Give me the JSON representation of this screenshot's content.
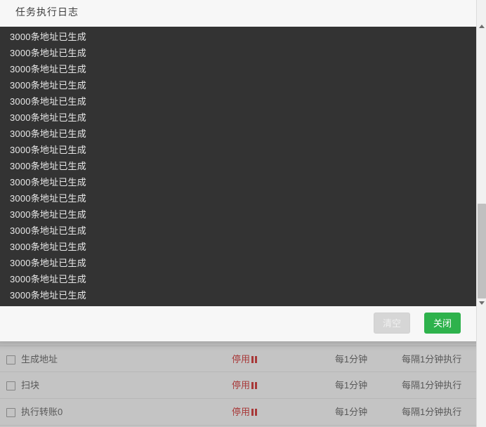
{
  "modal": {
    "title": "任务执行日志",
    "log_line_text": "3000条地址已生成",
    "log_lines": [
      "3000条地址已生成",
      "3000条地址已生成",
      "3000条地址已生成",
      "3000条地址已生成",
      "3000条地址已生成",
      "3000条地址已生成",
      "3000条地址已生成",
      "3000条地址已生成",
      "3000条地址已生成",
      "3000条地址已生成",
      "3000条地址已生成",
      "3000条地址已生成",
      "3000条地址已生成",
      "3000条地址已生成",
      "3000条地址已生成",
      "3000条地址已生成",
      "3000条地址已生成"
    ],
    "footer": {
      "clear_label": "清空",
      "close_label": "关闭"
    },
    "colors": {
      "log_background": "#333333",
      "log_text": "#e9e9e9",
      "close_button": "#2eb24c",
      "clear_button": "#d6d6d6",
      "panel_background": "#f7f7f7"
    }
  },
  "background_table": {
    "rows": [
      {
        "checkbox": "checkbox-unchecked",
        "name": "生成地址",
        "status": "停用",
        "status_icon": "pause-icon",
        "frequency": "每1分钟",
        "description": "每隔1分钟执行"
      },
      {
        "checkbox": "checkbox-unchecked",
        "name": "扫块",
        "status": "停用",
        "status_icon": "pause-icon",
        "frequency": "每1分钟",
        "description": "每隔1分钟执行"
      },
      {
        "checkbox": "checkbox-unchecked",
        "name": "执行转账0",
        "status": "停用",
        "status_icon": "pause-icon",
        "frequency": "每1分钟",
        "description": "每隔1分钟执行"
      }
    ],
    "status_color": "#cc0000"
  },
  "scrollbar": {
    "up_arrow": "triangle-up-icon",
    "down_arrow": "triangle-down-icon",
    "thumb": "scrollbar-thumb"
  }
}
